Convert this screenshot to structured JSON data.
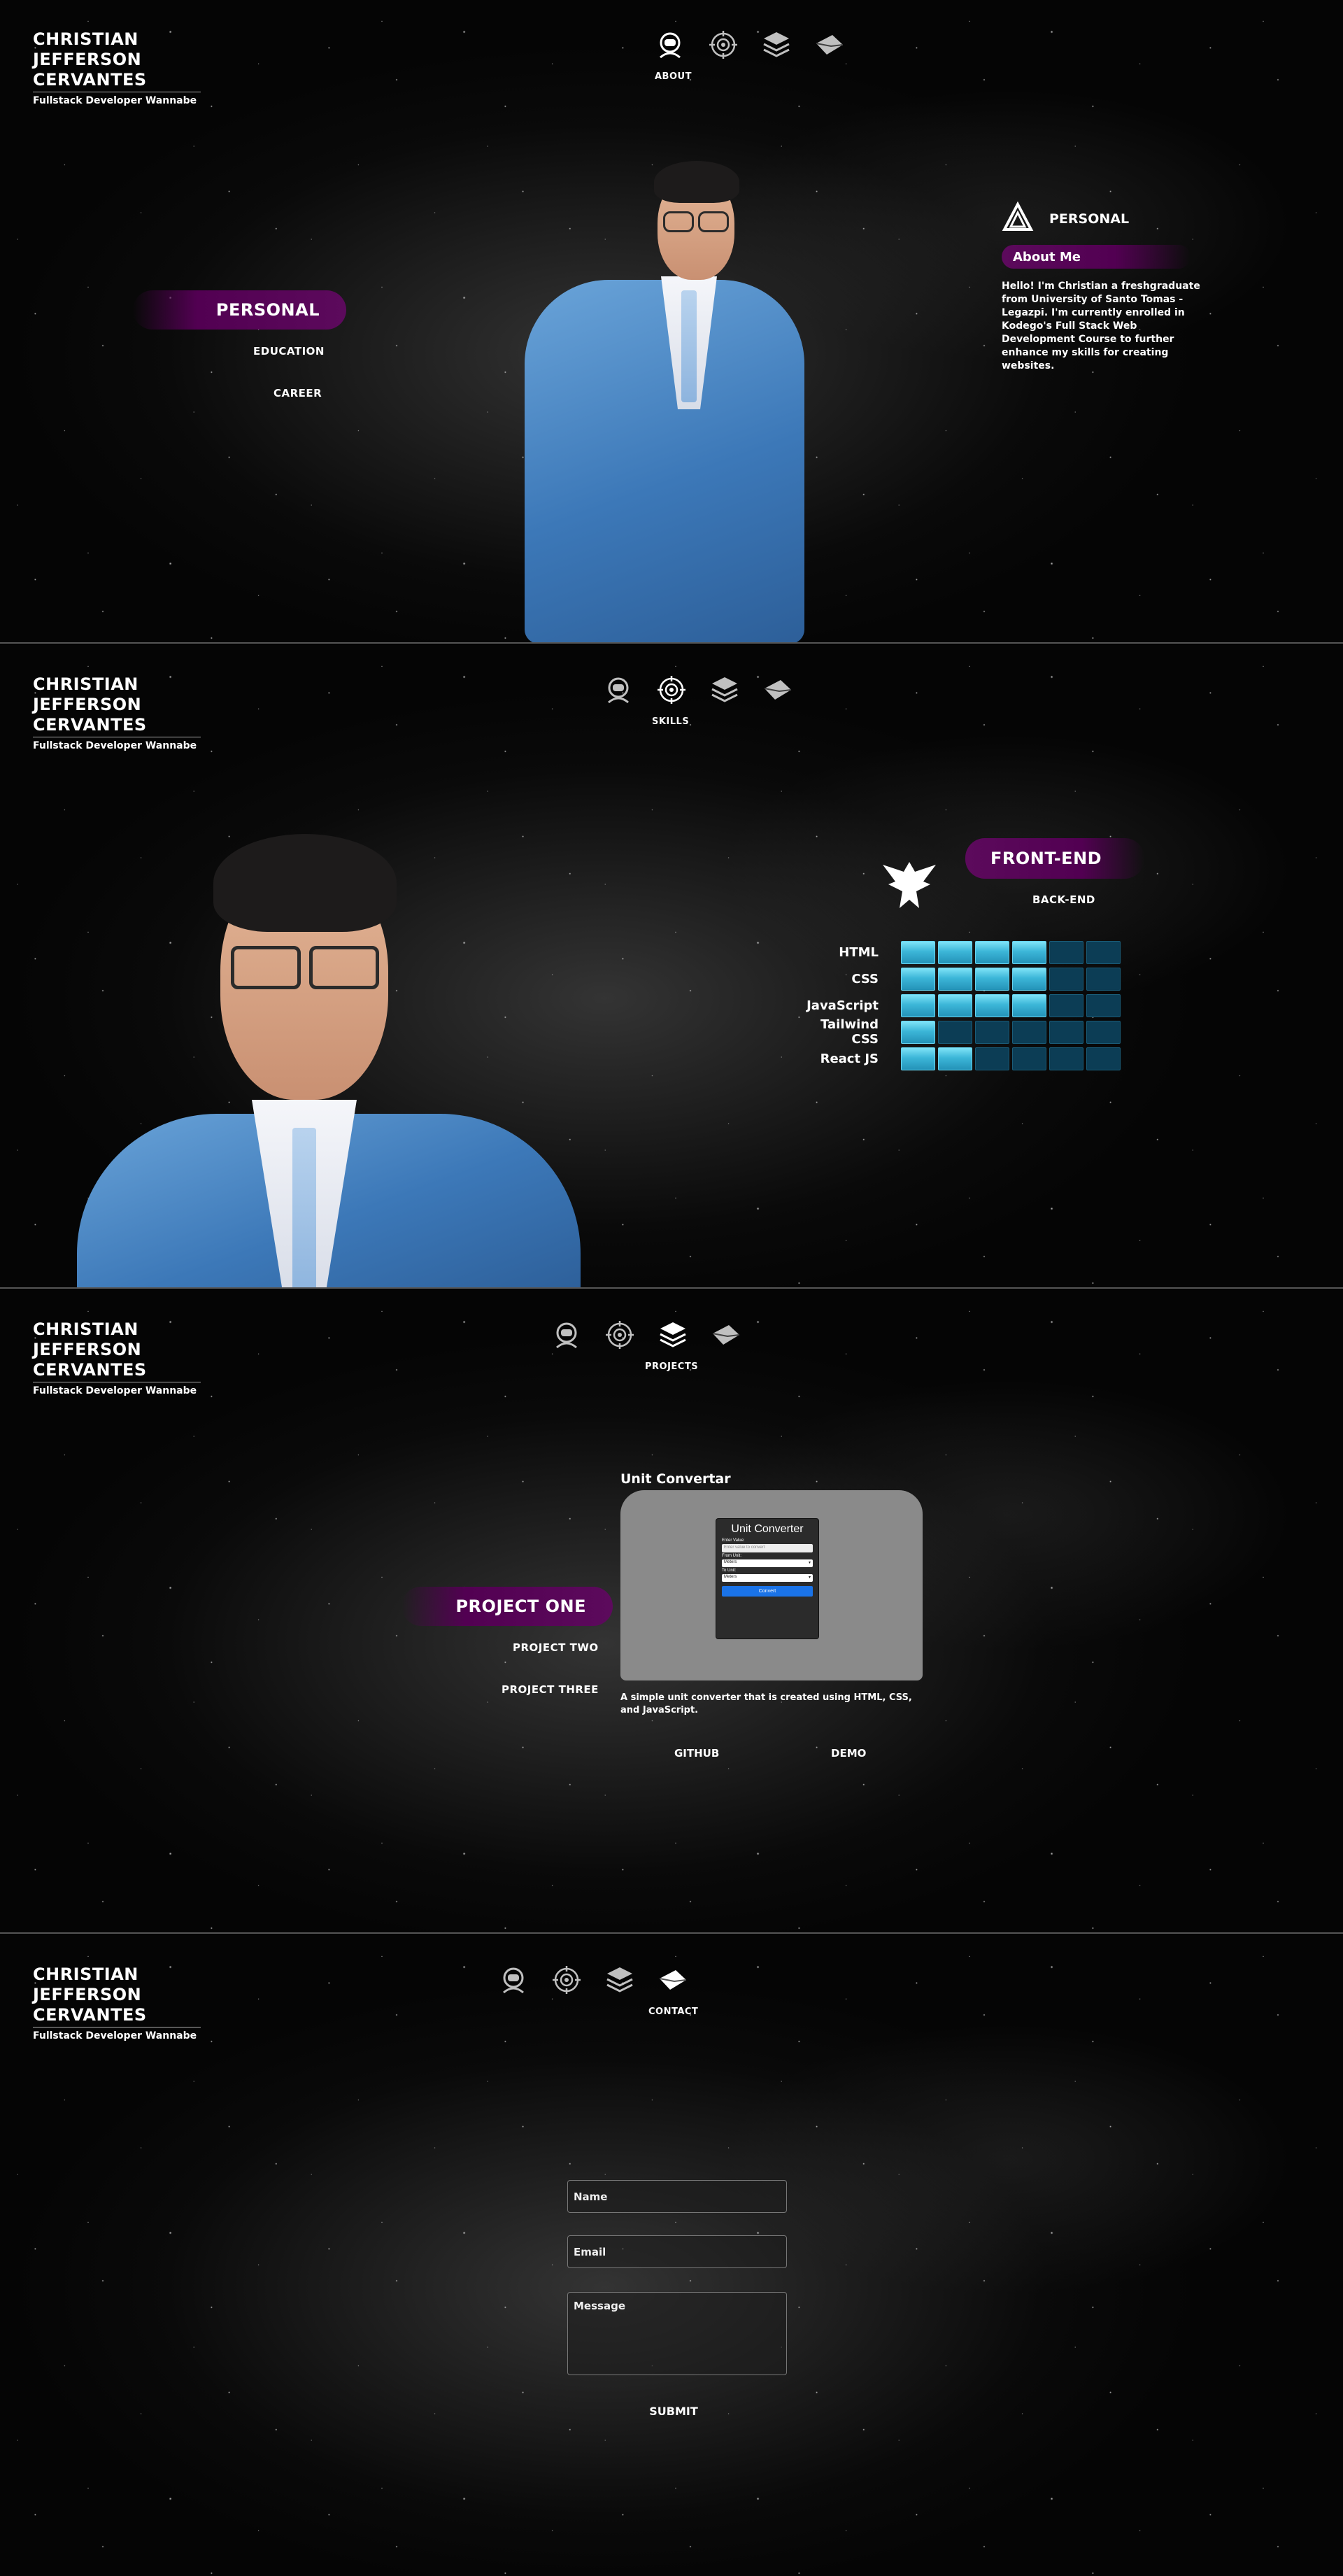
{
  "brand": {
    "name": "Christian Jefferson Cervantes",
    "tagline": "Fullstack Developer Wannabe"
  },
  "nav": {
    "icons": [
      "astronaut-icon",
      "target-icon",
      "layers-icon",
      "envelope-icon"
    ],
    "labels": {
      "about": "About",
      "skills": "Skills",
      "projects": "Projects",
      "contact": "Contact"
    }
  },
  "about": {
    "tabs": [
      "Personal",
      "Education",
      "Career"
    ],
    "card_title": "Personal",
    "card_subtitle": "About Me",
    "text": "Hello! I'm Christian a freshgraduate from University of Santo Tomas - Legazpi. I'm currently enrolled in Kodego's Full Stack Web Development Course to further enhance my skills for creating websites."
  },
  "skills": {
    "tabs": [
      "Front-End",
      "Back-End"
    ],
    "rows": [
      {
        "label": "HTML",
        "level": 4,
        "max": 6
      },
      {
        "label": "CSS",
        "level": 4,
        "max": 6
      },
      {
        "label": "JavaScript",
        "level": 4,
        "max": 6
      },
      {
        "label": "Tailwind CSS",
        "level": 1,
        "max": 6
      },
      {
        "label": "React JS",
        "level": 2,
        "max": 6
      }
    ]
  },
  "projects": {
    "tabs": [
      "Project One",
      "Project Two",
      "Project Three"
    ],
    "title": "Unit Convertar",
    "preview": {
      "title": "Unit Converter",
      "enter_label": "Enter Value:",
      "enter_placeholder": "Enter value to convert",
      "from_label": "From Unit:",
      "from_value": "Meters",
      "to_label": "To Unit:",
      "to_value": "Meters",
      "button": "Convert"
    },
    "description": "A simple unit converter that is created using HTML, CSS, and JavaScript.",
    "links": [
      "Github",
      "Demo"
    ]
  },
  "contact": {
    "name_placeholder": "Name",
    "email_placeholder": "Email",
    "message_placeholder": "Message",
    "submit": "Submit"
  },
  "colors": {
    "accent_purple": "#520052",
    "skill_on": "#3cb6d8",
    "skill_off": "#0c3d55"
  }
}
